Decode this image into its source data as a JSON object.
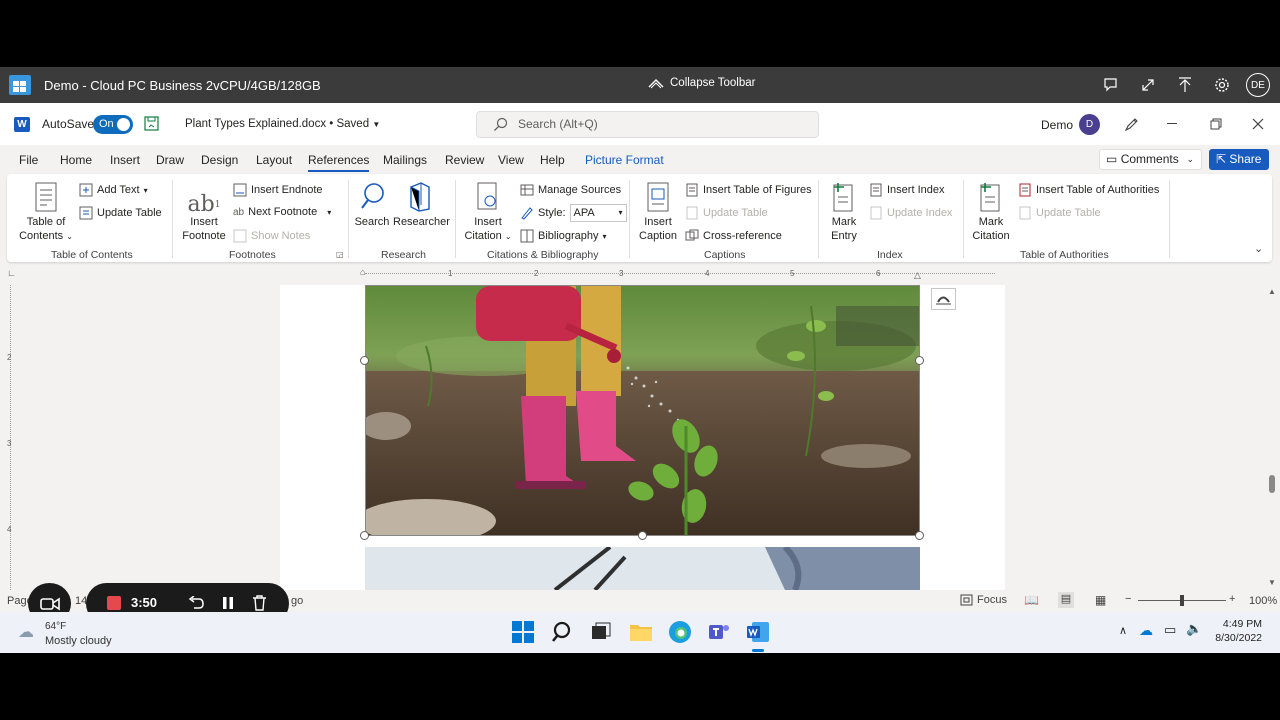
{
  "cloud_pc": {
    "title": "Demo - Cloud PC Business 2vCPU/4GB/128GB",
    "collapse_label": "Collapse Toolbar",
    "avatar": "DE"
  },
  "word": {
    "autosave_label": "AutoSave",
    "autosave_state": "On",
    "doc_title": "Plant Types Explained.docx • Saved",
    "search_placeholder": "Search (Alt+Q)",
    "user_name": "Demo",
    "user_initial": "D",
    "tabs": [
      "File",
      "Home",
      "Insert",
      "Draw",
      "Design",
      "Layout",
      "References",
      "Mailings",
      "Review",
      "View",
      "Help",
      "Picture Format"
    ],
    "active_tab": "References",
    "comments_label": "Comments",
    "share_label": "Share"
  },
  "ribbon": {
    "toc": {
      "table_of_contents": "Table of Contents",
      "add_text": "Add Text",
      "update_table": "Update Table",
      "group": "Table of Contents"
    },
    "footnotes": {
      "insert_footnote": "Insert Footnote",
      "insert_endnote": "Insert Endnote",
      "next_footnote": "Next Footnote",
      "show_notes": "Show Notes",
      "group": "Footnotes"
    },
    "research": {
      "search": "Search",
      "researcher": "Researcher",
      "group": "Research"
    },
    "citations": {
      "insert_citation": "Insert Citation",
      "manage_sources": "Manage Sources",
      "style_label": "Style:",
      "style_value": "APA",
      "bibliography": "Bibliography",
      "group": "Citations & Bibliography"
    },
    "captions": {
      "insert_caption": "Insert Caption",
      "insert_table_of_figures": "Insert Table of Figures",
      "update_table": "Update Table",
      "cross_reference": "Cross-reference",
      "group": "Captions"
    },
    "index": {
      "mark_entry": "Mark Entry",
      "insert_index": "Insert Index",
      "update_index": "Update Index",
      "group": "Index"
    },
    "authorities": {
      "mark_citation": "Mark Citation",
      "insert_table_of_authorities": "Insert Table of Authorities",
      "update_table": "Update Table",
      "group": "Table of Authorities"
    }
  },
  "ruler": {
    "numbers": [
      "1",
      "2",
      "3",
      "4",
      "5",
      "6"
    ]
  },
  "vruler": {
    "numbers": [
      "2",
      "3",
      "4"
    ]
  },
  "statusbar": {
    "page_label": "Page",
    "page_num": "14",
    "partial_text": "go",
    "focus_label": "Focus",
    "zoom": "100%"
  },
  "recorder": {
    "time": "3:50"
  },
  "taskbar": {
    "temp": "64°F",
    "weather": "Mostly cloudy",
    "time": "4:49 PM",
    "date": "8/30/2022"
  },
  "colors": {
    "word_blue": "#185abd",
    "cpc_bar": "#3b3b3b",
    "record_red": "#e5484d"
  }
}
